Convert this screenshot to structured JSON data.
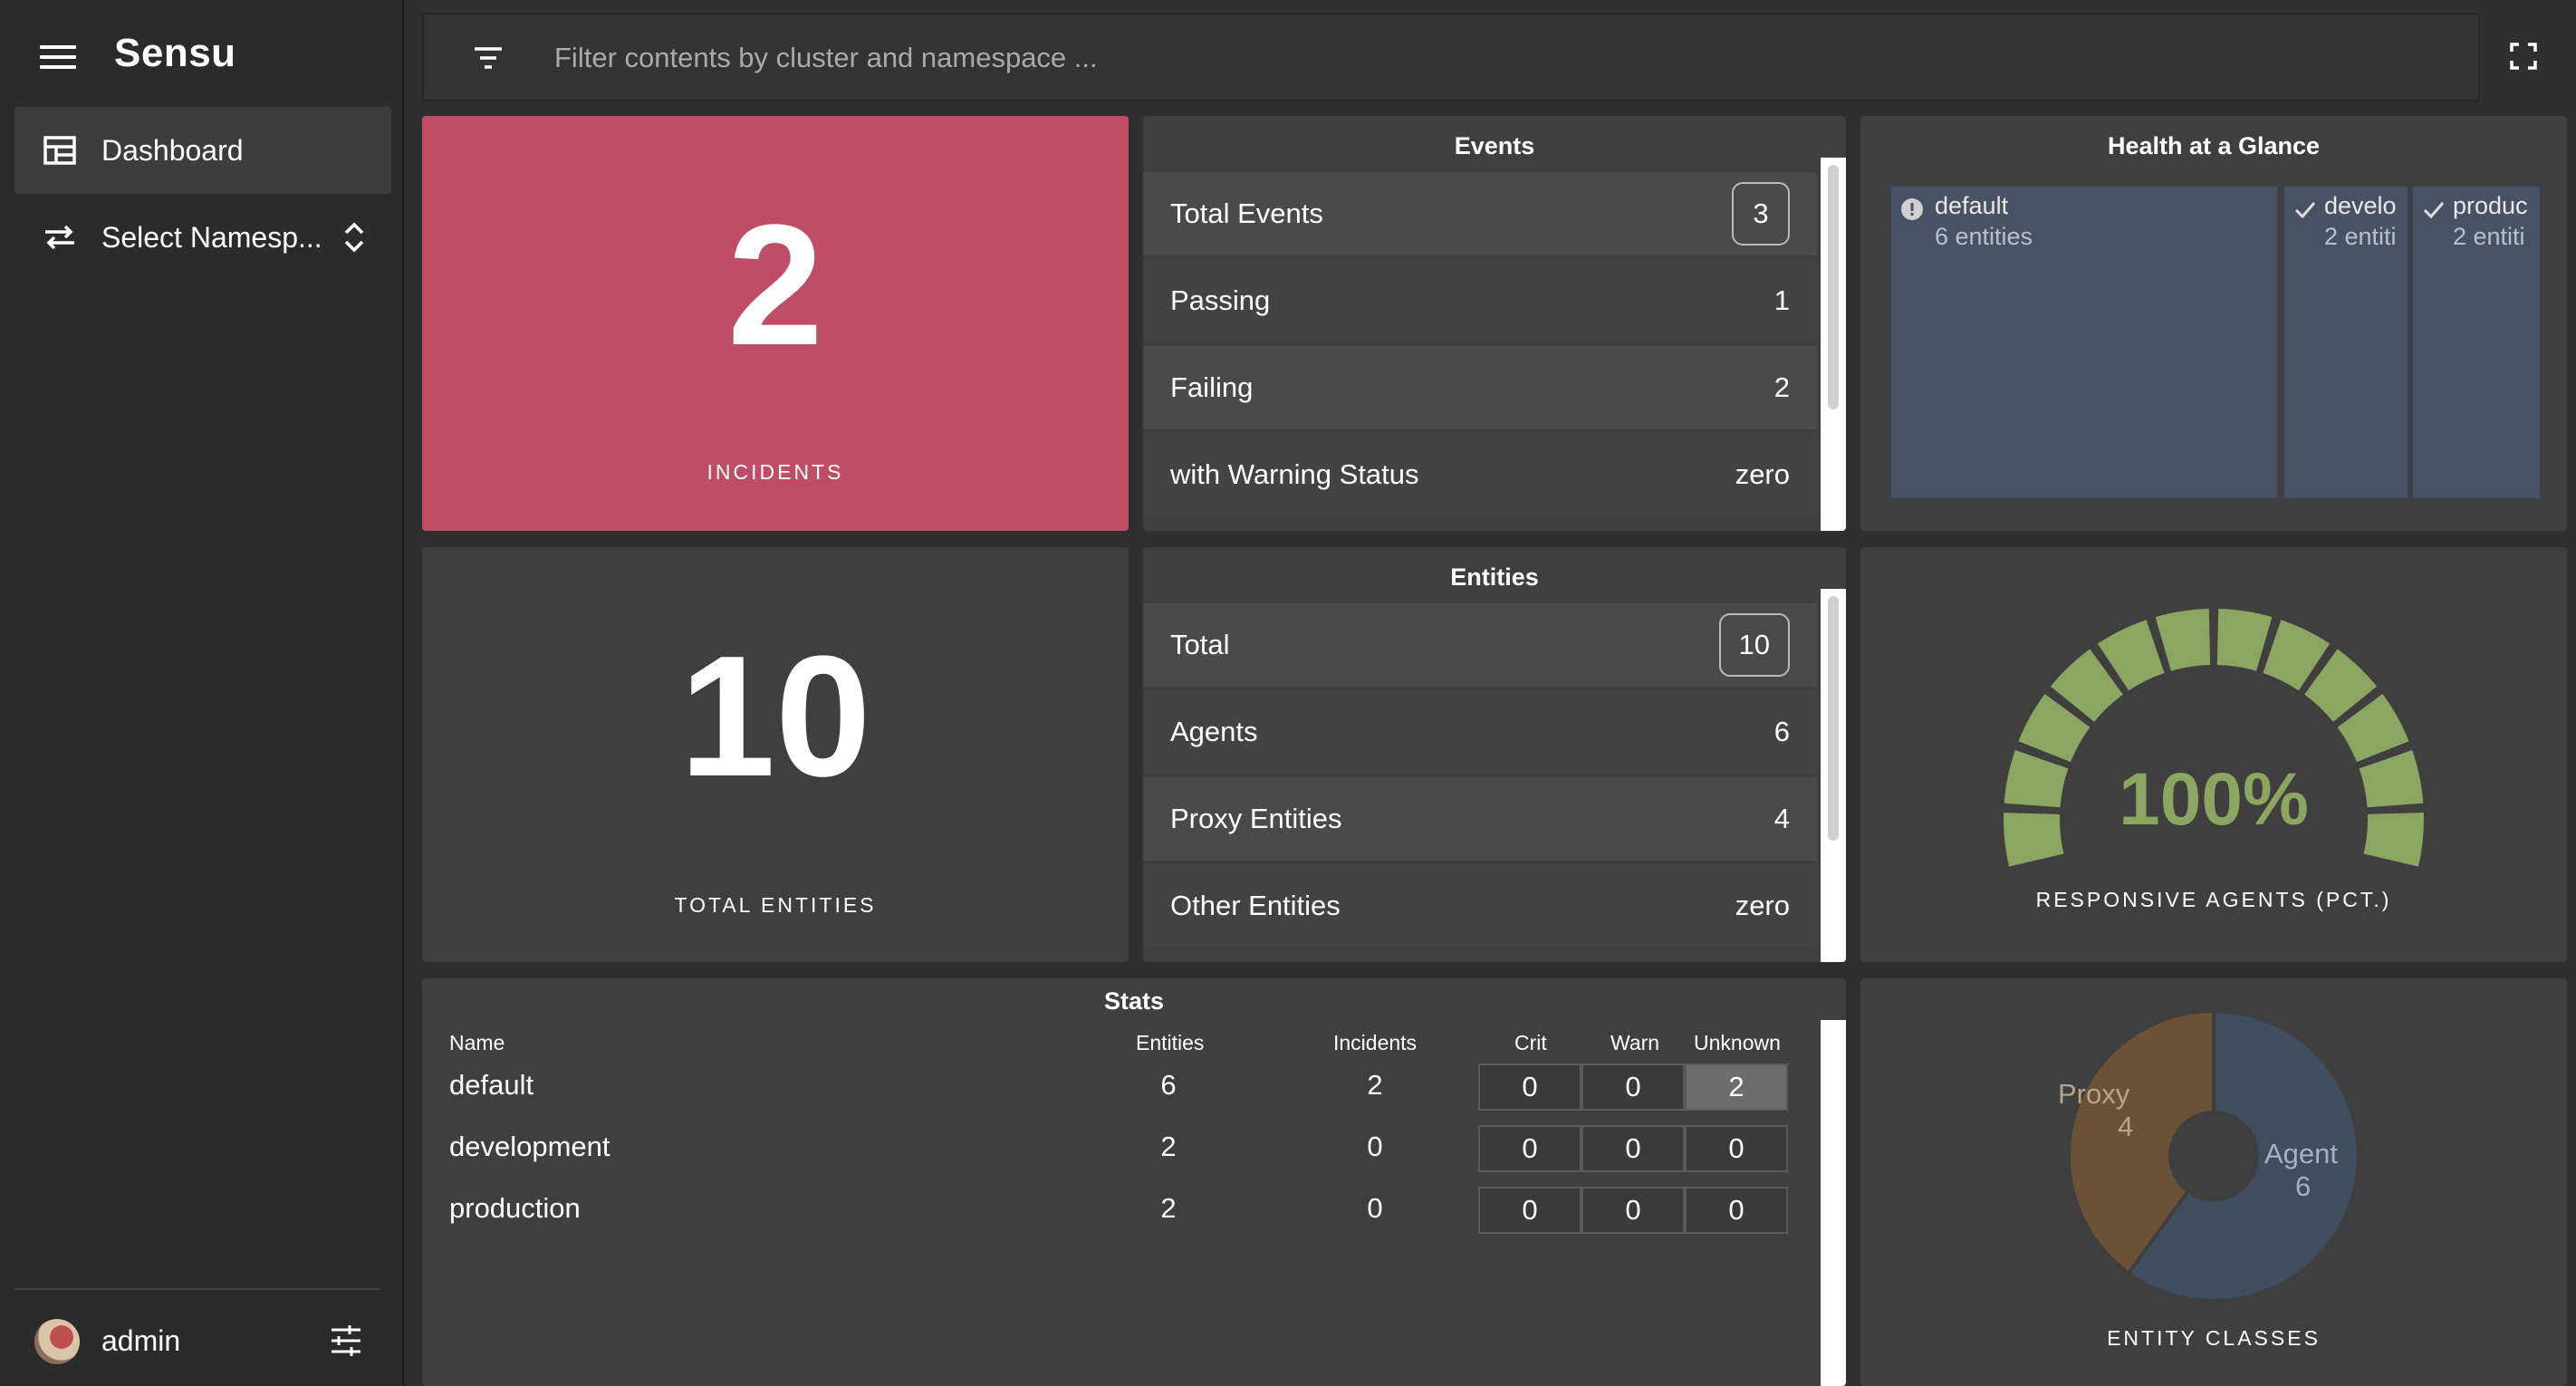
{
  "app": {
    "brand": "Sensu"
  },
  "sidebar": {
    "items": [
      {
        "label": "Dashboard",
        "icon": "dashboard-icon"
      },
      {
        "label": "Select Namesp...",
        "icon": "swap-icon"
      }
    ],
    "user": {
      "name": "admin"
    }
  },
  "filter": {
    "placeholder": "Filter contents by cluster and namespace ..."
  },
  "incidents": {
    "value": "2",
    "label": "INCIDENTS",
    "color": "#bf4d65"
  },
  "entities_total": {
    "value": "10",
    "label": "TOTAL ENTITIES"
  },
  "events": {
    "title": "Events",
    "rows": [
      {
        "label": "Total Events",
        "value": "3"
      },
      {
        "label": "Passing",
        "value": "1"
      },
      {
        "label": "Failing",
        "value": "2"
      },
      {
        "label": "with Warning Status",
        "value": "zero"
      }
    ]
  },
  "entities": {
    "title": "Entities",
    "rows": [
      {
        "label": "Total",
        "value": "10"
      },
      {
        "label": "Agents",
        "value": "6"
      },
      {
        "label": "Proxy Entities",
        "value": "4"
      },
      {
        "label": "Other Entities",
        "value": "zero"
      }
    ]
  },
  "health": {
    "title": "Health at a Glance",
    "namespaces": [
      {
        "name": "default",
        "entities": "6 entities",
        "status": "warning"
      },
      {
        "name": "develo",
        "entities": "2 entiti",
        "status": "ok"
      },
      {
        "name": "produc",
        "entities": "2 entiti",
        "status": "ok"
      }
    ]
  },
  "responsive": {
    "value": "100%",
    "label": "RESPONSIVE AGENTS (PCT.)",
    "fraction": 1.0,
    "color": "#8aa661"
  },
  "stats": {
    "title": "Stats",
    "headers": {
      "name": "Name",
      "entities": "Entities",
      "incidents": "Incidents",
      "crit": "Crit",
      "warn": "Warn",
      "unknown": "Unknown"
    },
    "rows": [
      {
        "name": "default",
        "entities": "6",
        "incidents": "2",
        "crit": "0",
        "warn": "0",
        "unknown": "2"
      },
      {
        "name": "development",
        "entities": "2",
        "incidents": "0",
        "crit": "0",
        "warn": "0",
        "unknown": "0"
      },
      {
        "name": "production",
        "entities": "2",
        "incidents": "0",
        "crit": "0",
        "warn": "0",
        "unknown": "0"
      }
    ]
  },
  "entity_classes": {
    "label": "ENTITY CLASSES",
    "slices": [
      {
        "name": "Proxy",
        "value": "4",
        "color": "#6b5136"
      },
      {
        "name": "Agent",
        "value": "6",
        "color": "#3f4d5f"
      }
    ]
  }
}
